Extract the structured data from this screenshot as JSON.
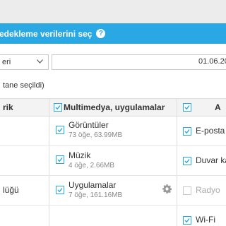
{
  "header": {
    "title": "edekleme verilerini seç",
    "help_icon": "question-circle-icon"
  },
  "filter": {
    "select_value": "eri",
    "date_value": "01.06.201"
  },
  "selection_count": "tane seçildi)",
  "columns": {
    "col1": {
      "label": "rik"
    },
    "col2": {
      "label": "Multimedya, uygulamalar",
      "checked": true
    },
    "col3": {
      "label": "A",
      "checked": true
    }
  },
  "left_rows": [
    "lüğü"
  ],
  "multimedia_items": [
    {
      "name": "Görüntüler",
      "detail": "73 öğe, 63.99MB",
      "checked": true
    },
    {
      "name": "Müzik",
      "detail": "4 öğe, 2.66MB",
      "checked": true
    },
    {
      "name": "Uygulamalar",
      "detail": "7 öğe, 161.16MB",
      "checked": true,
      "settings_icon": "gear-icon"
    }
  ],
  "other_items": [
    {
      "name": "E-posta",
      "checked": true,
      "enabled": true
    },
    {
      "name": "Duvar ka",
      "checked": true,
      "enabled": true
    },
    {
      "name": "Radyo",
      "checked": false,
      "enabled": false
    },
    {
      "name": "Wi-Fi",
      "checked": true,
      "enabled": true
    }
  ],
  "colors": {
    "accent": "#29a8e3",
    "header_bg": "#f3f3f3"
  }
}
